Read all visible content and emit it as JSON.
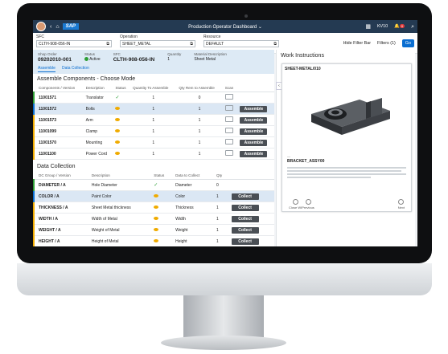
{
  "shell": {
    "brand": "SAP",
    "title": "Production Operator Dashboard",
    "plant": "KV10",
    "notifications": "0"
  },
  "filter": {
    "sfc_label": "SFC",
    "sfc_value": "CLTH-908-056-IN",
    "operation_label": "Operation",
    "operation_value": "SHEET_METAL",
    "resource_label": "Resource",
    "resource_value": "DEFAULT",
    "hide_filter_bar": "Hide Filter Bar",
    "filters": "Filters (1)",
    "go": "Go"
  },
  "header": {
    "shop_order_label": "Shop Order",
    "shop_order_value": "09202010-001",
    "status_label": "Status",
    "status_value": "Active",
    "sfc_label": "SFC",
    "sfc_value": "CLTH-908-056-IN",
    "quantity_label": "Quantity",
    "quantity_value": "1",
    "material_label": "Material Description",
    "material_value": "Sheet Metal",
    "tabs": [
      "Assemble",
      "Data Collection"
    ]
  },
  "assemble": {
    "title": "Assemble Components - Choose Mode",
    "columns": [
      "Components / Version",
      "Description",
      "Status",
      "Quantity To Assemble",
      "Qty Rem to Assemble",
      "Scan"
    ],
    "button_label": "Assemble",
    "rows": [
      {
        "component": "11001571",
        "description": "Translator",
        "status": "done",
        "qty": "1",
        "rem": "0",
        "flag": "g"
      },
      {
        "component": "11001572",
        "description": "Bolts",
        "status": "pending",
        "qty": "1",
        "rem": "1",
        "flag": "b"
      },
      {
        "component": "11001573",
        "description": "Arm",
        "status": "pending",
        "qty": "1",
        "rem": "1",
        "flag": "y"
      },
      {
        "component": "11001099",
        "description": "Clamp",
        "status": "pending",
        "qty": "1",
        "rem": "1",
        "flag": "y"
      },
      {
        "component": "11001570",
        "description": "Mounting",
        "status": "pending",
        "qty": "1",
        "rem": "1",
        "flag": "y"
      },
      {
        "component": "11001100",
        "description": "Power Cord",
        "status": "pending",
        "qty": "1",
        "rem": "1",
        "flag": "y"
      }
    ]
  },
  "datacollection": {
    "title": "Data Collection",
    "columns": [
      "DC Group / Version",
      "Description",
      "Status",
      "Data to Collect",
      "Qty"
    ],
    "button_label": "Collect",
    "rows": [
      {
        "group": "DIAMETER / A",
        "description": "Hole Diameter",
        "status": "done",
        "data": "Diameter",
        "qty": "0",
        "flag": "g"
      },
      {
        "group": "COLOR / A",
        "description": "Paint Color",
        "status": "pending",
        "data": "Color",
        "qty": "1",
        "flag": "b"
      },
      {
        "group": "THICKNESS / A",
        "description": "Sheet Metal thickness",
        "status": "pending",
        "data": "Thickness",
        "qty": "1",
        "flag": "y"
      },
      {
        "group": "WIDTH / A",
        "description": "Width of Metal",
        "status": "pending",
        "data": "Width",
        "qty": "1",
        "flag": "y"
      },
      {
        "group": "WEIGHT / A",
        "description": "Weight of Metal",
        "status": "pending",
        "data": "Weight",
        "qty": "1",
        "flag": "y"
      },
      {
        "group": "HEIGHT / A",
        "description": "Height of Metal",
        "status": "pending",
        "data": "Height",
        "qty": "1",
        "flag": "y"
      }
    ]
  },
  "work_instructions": {
    "title": "Work Instructions",
    "doc_title": "SHEET-METAL/010",
    "part_name": "BRACKET_ASSY00",
    "prev_label": "Previous",
    "next_label": "Next",
    "close_label": "Close WI"
  },
  "colors": {
    "shell": "#243a52",
    "accent": "#0a6ed1",
    "success": "#2e9e36",
    "warning": "#f0ab00"
  }
}
